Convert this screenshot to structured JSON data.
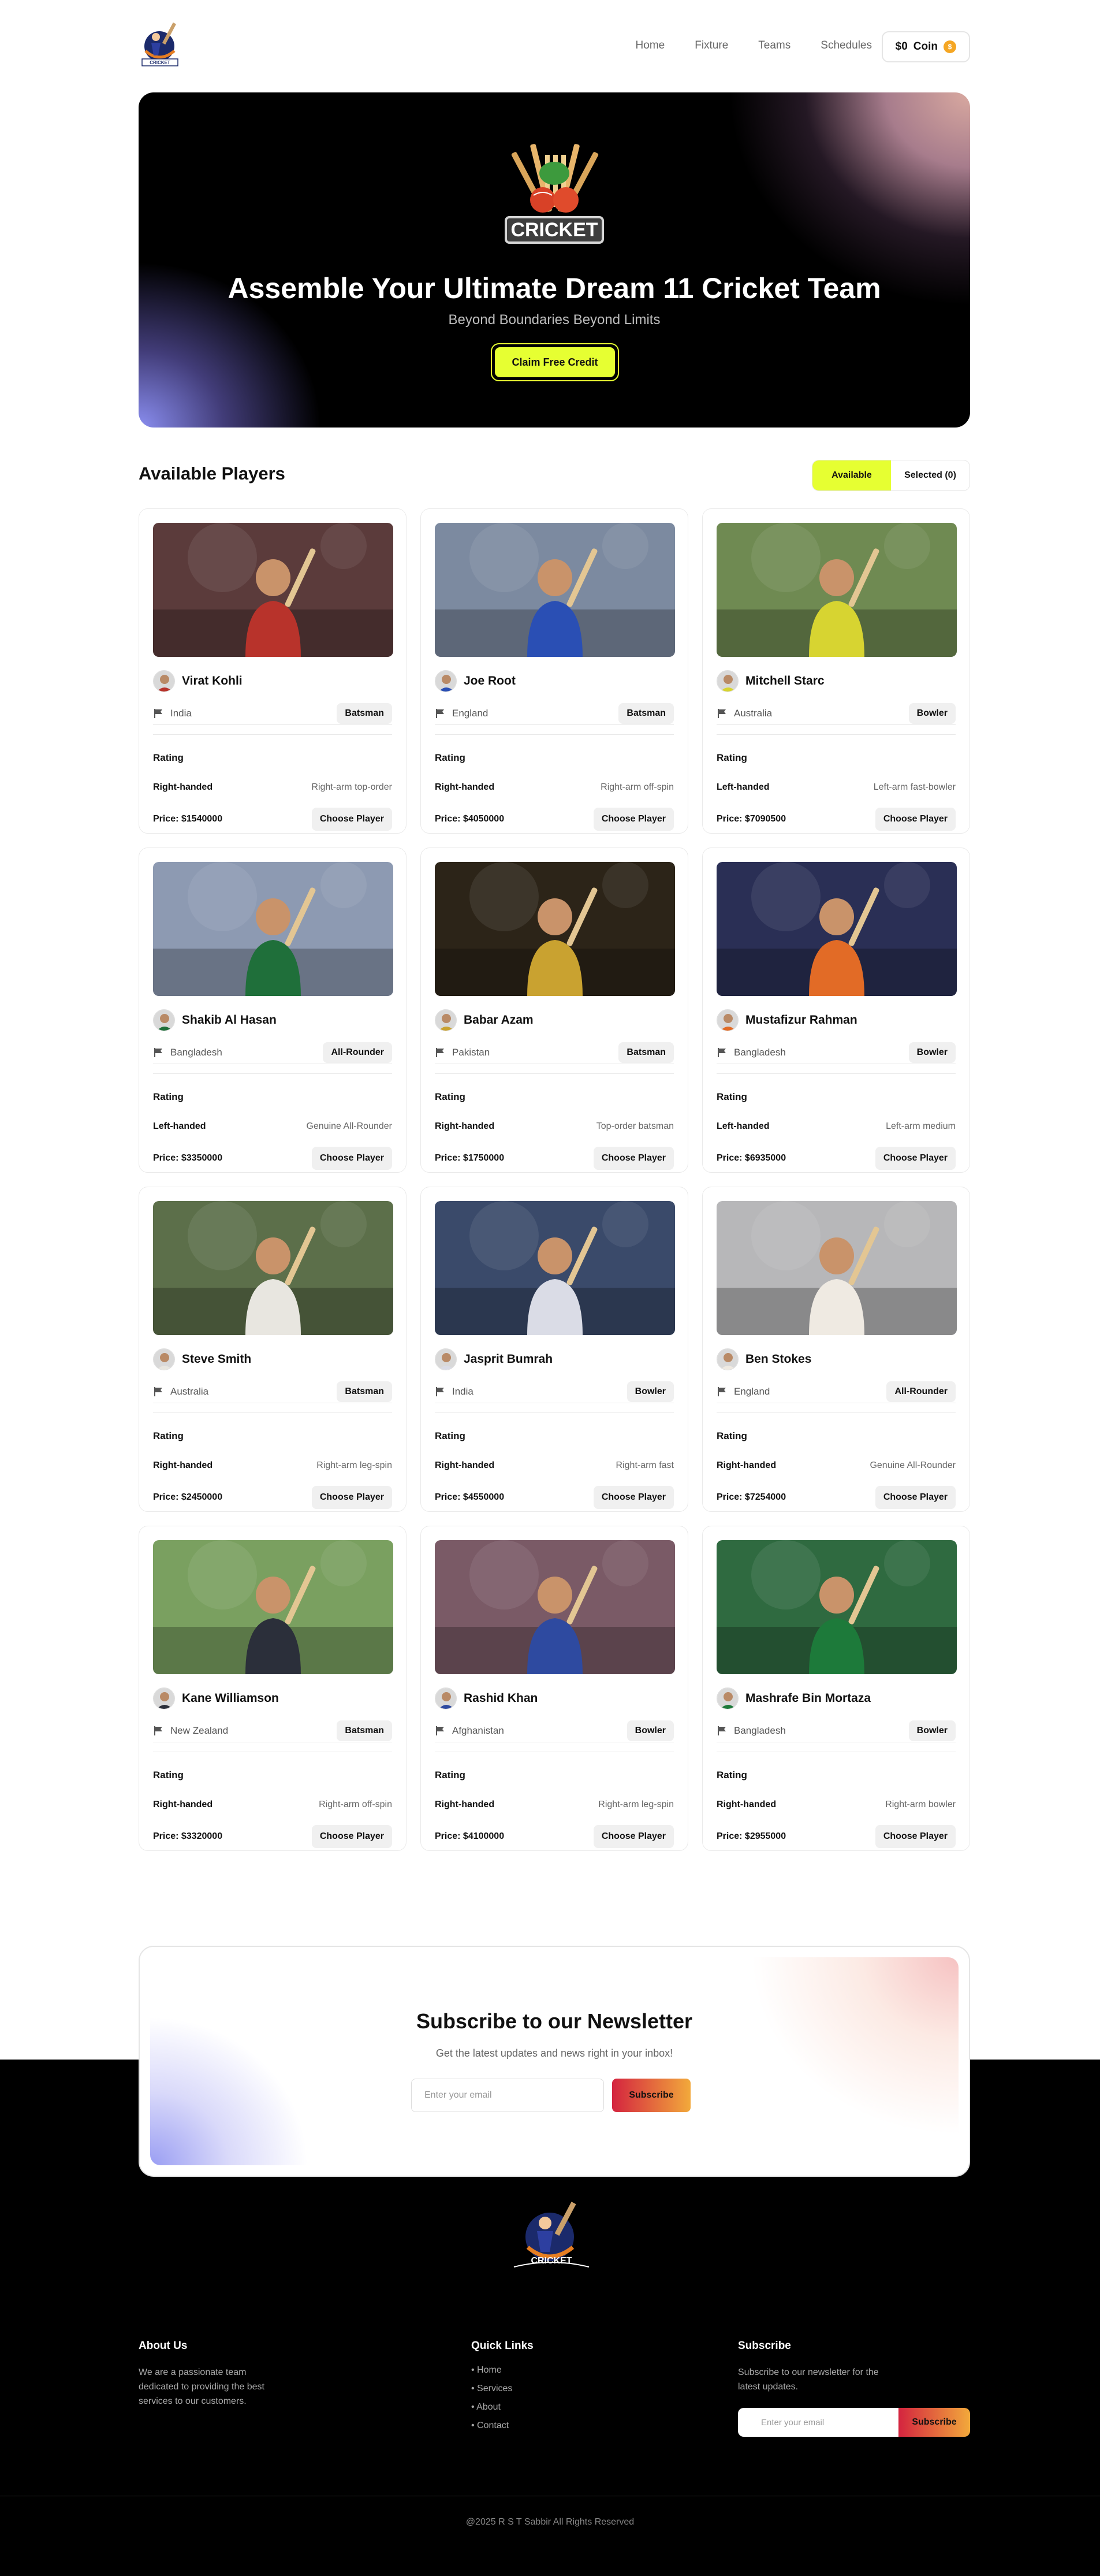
{
  "nav": {
    "links": [
      "Home",
      "Fixture",
      "Teams",
      "Schedules"
    ],
    "coin_amount": "$0",
    "coin_label": "Coin"
  },
  "hero": {
    "logo_text": "CRICKET",
    "title": "Assemble Your Ultimate Dream 11 Cricket Team",
    "subtitle": "Beyond Boundaries Beyond Limits",
    "cta": "Claim Free Credit"
  },
  "players_section": {
    "title": "Available Players",
    "toggle": [
      "Available",
      "Selected (0)"
    ]
  },
  "card_labels": {
    "rating": "Rating",
    "choose": "Choose Player"
  },
  "players": [
    {
      "name": "Virat Kohli",
      "country": "India",
      "role": "Batsman",
      "hand": "Right-handed",
      "style": "Right-arm top-order",
      "price": "Price: $1540000",
      "color": "#b8332b"
    },
    {
      "name": "Joe Root",
      "country": "England",
      "role": "Batsman",
      "hand": "Right-handed",
      "style": "Right-arm off-spin",
      "price": "Price: $4050000",
      "color": "#2a4fb4"
    },
    {
      "name": "Mitchell Starc",
      "country": "Australia",
      "role": "Bowler",
      "hand": "Left-handed",
      "style": "Left-arm fast-bowler",
      "price": "Price: $7090500",
      "color": "#d7d431"
    },
    {
      "name": "Shakib Al Hasan",
      "country": "Bangladesh",
      "role": "All-Rounder",
      "hand": "Left-handed",
      "style": "Genuine All-Rounder",
      "price": "Price: $3350000",
      "color": "#1f6f3a"
    },
    {
      "name": "Babar Azam",
      "country": "Pakistan",
      "role": "Batsman",
      "hand": "Right-handed",
      "style": "Top-order batsman",
      "price": "Price: $1750000",
      "color": "#c9a230"
    },
    {
      "name": "Mustafizur Rahman",
      "country": "Bangladesh",
      "role": "Bowler",
      "hand": "Left-handed",
      "style": "Left-arm medium",
      "price": "Price: $6935000",
      "color": "#e26b26"
    },
    {
      "name": "Steve Smith",
      "country": "Australia",
      "role": "Batsman",
      "hand": "Right-handed",
      "style": "Right-arm leg-spin",
      "price": "Price: $2450000",
      "color": "#e8e6e0"
    },
    {
      "name": "Jasprit Bumrah",
      "country": "India",
      "role": "Bowler",
      "hand": "Right-handed",
      "style": "Right-arm fast",
      "price": "Price: $4550000",
      "color": "#dadce6"
    },
    {
      "name": "Ben Stokes",
      "country": "England",
      "role": "All-Rounder",
      "hand": "Right-handed",
      "style": "Genuine All-Rounder",
      "price": "Price: $7254000",
      "color": "#efeae2"
    },
    {
      "name": "Kane Williamson",
      "country": "New Zealand",
      "role": "Batsman",
      "hand": "Right-handed",
      "style": "Right-arm off-spin",
      "price": "Price: $3320000",
      "color": "#2b2f3a"
    },
    {
      "name": "Rashid Khan",
      "country": "Afghanistan",
      "role": "Bowler",
      "hand": "Right-handed",
      "style": "Right-arm leg-spin",
      "price": "Price: $4100000",
      "color": "#2e4aa0"
    },
    {
      "name": "Mashrafe Bin Mortaza",
      "country": "Bangladesh",
      "role": "Bowler",
      "hand": "Right-handed",
      "style": "Right-arm bowler",
      "price": "Price: $2955000",
      "color": "#1d7a3a"
    }
  ],
  "newsletter": {
    "title": "Subscribe to our Newsletter",
    "subtitle": "Get the latest updates and news right in your inbox!",
    "placeholder": "Enter your email",
    "button": "Subscribe"
  },
  "footer": {
    "logo_text": "CRICKET",
    "about_title": "About Us",
    "about_text": "We are a passionate team dedicated to providing the best services to our customers.",
    "links_title": "Quick Links",
    "links": [
      "Home",
      "Services",
      "About",
      "Contact"
    ],
    "subscribe_title": "Subscribe",
    "subscribe_text": "Subscribe to our newsletter for the latest updates.",
    "placeholder": "Enter your email",
    "button": "Subscribe",
    "copyright": "@2025 R S T Sabbir All Rights Reserved"
  }
}
